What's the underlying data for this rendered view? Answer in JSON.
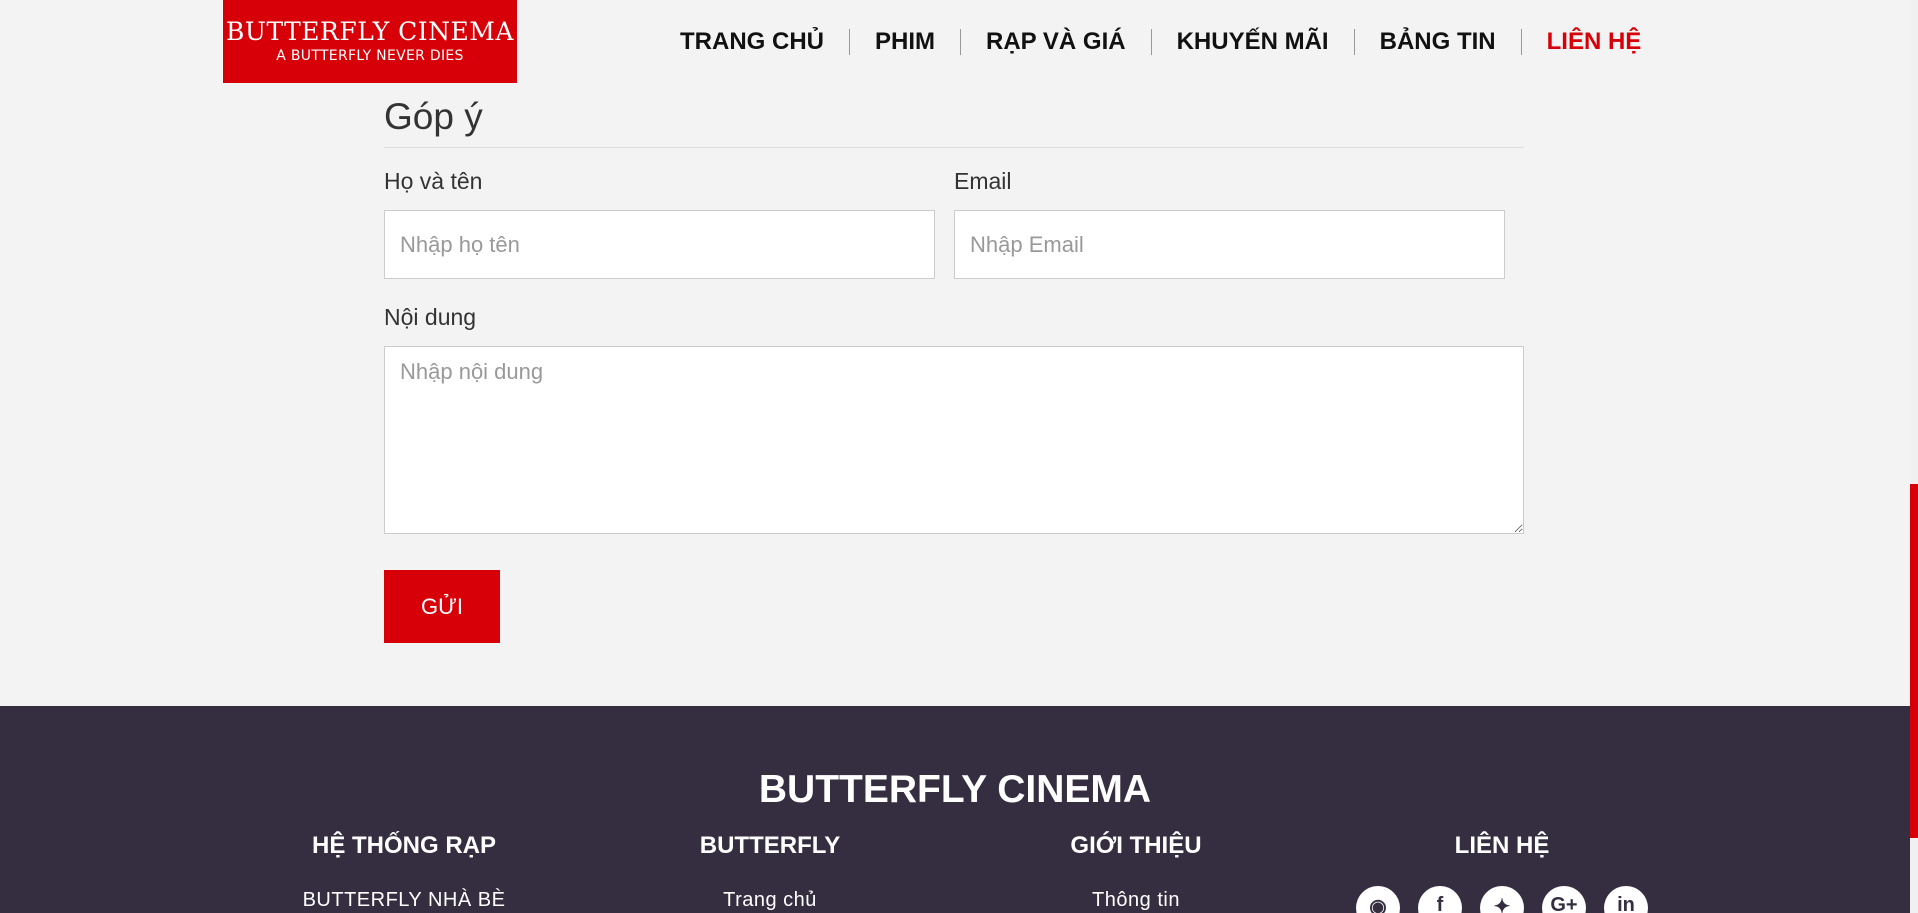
{
  "logo": {
    "title": "BUTTERFLY CINEMA",
    "tagline": "A BUTTERFLY NEVER DIES"
  },
  "nav": {
    "items": [
      {
        "label": "TRANG CHỦ"
      },
      {
        "label": "PHIM"
      },
      {
        "label": "RẠP VÀ GIÁ"
      },
      {
        "label": "KHUYẾN MÃI"
      },
      {
        "label": "BẢNG TIN"
      },
      {
        "label": "LIÊN HỆ"
      }
    ],
    "active_index": 5
  },
  "form": {
    "title": "Góp ý",
    "name_label": "Họ và tên",
    "name_placeholder": "Nhập họ tên",
    "email_label": "Email",
    "email_placeholder": "Nhập Email",
    "content_label": "Nội dung",
    "content_placeholder": "Nhập nội dung",
    "submit_label": "GỬI"
  },
  "footer": {
    "brand": "BUTTERFLY CINEMA",
    "columns": [
      {
        "heading": "HỆ THỐNG RẠP",
        "links": [
          "BUTTERFLY NHÀ BÈ"
        ]
      },
      {
        "heading": "BUTTERFLY",
        "links": [
          "Trang chủ"
        ]
      },
      {
        "heading": "GIỚI THIỆU",
        "links": [
          "Thông tin"
        ]
      },
      {
        "heading": "LIÊN HỆ",
        "links": []
      }
    ],
    "socials": [
      {
        "icon": "rss-icon",
        "glyph": "◉"
      },
      {
        "icon": "facebook-icon",
        "glyph": "f"
      },
      {
        "icon": "twitter-icon",
        "glyph": "✦"
      },
      {
        "icon": "google-plus-icon",
        "glyph": "G+"
      },
      {
        "icon": "linkedin-icon",
        "glyph": "in"
      }
    ]
  },
  "colors": {
    "brand_red": "#d70008",
    "footer_bg": "#352e41",
    "page_bg": "#f3f3f3"
  }
}
